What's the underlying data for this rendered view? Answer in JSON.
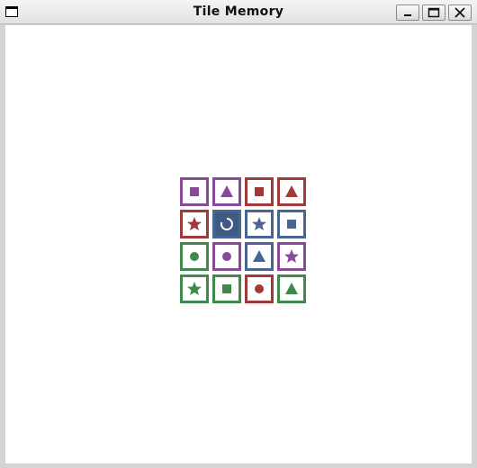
{
  "window": {
    "title": "Tile Memory",
    "buttons": [
      "minimize",
      "maximize",
      "close"
    ]
  },
  "colors": {
    "purple": "#8a4a9c",
    "red": "#a03a3a",
    "blue": "#4a6590",
    "green": "#3f8a4a",
    "selected_fill": "#3d5a84"
  },
  "board": {
    "rows": 4,
    "cols": 4,
    "tiles": [
      {
        "color": "purple",
        "shape": "square"
      },
      {
        "color": "purple",
        "shape": "triangle"
      },
      {
        "color": "red",
        "shape": "square"
      },
      {
        "color": "red",
        "shape": "triangle"
      },
      {
        "color": "red",
        "shape": "star"
      },
      {
        "color": "blue",
        "shape": "spinner",
        "state": "selected"
      },
      {
        "color": "blue",
        "shape": "star"
      },
      {
        "color": "blue",
        "shape": "square"
      },
      {
        "color": "green",
        "shape": "circle"
      },
      {
        "color": "purple",
        "shape": "circle"
      },
      {
        "color": "blue",
        "shape": "triangle"
      },
      {
        "color": "purple",
        "shape": "star"
      },
      {
        "color": "green",
        "shape": "star"
      },
      {
        "color": "green",
        "shape": "square"
      },
      {
        "color": "red",
        "shape": "circle"
      },
      {
        "color": "green",
        "shape": "triangle"
      }
    ]
  }
}
